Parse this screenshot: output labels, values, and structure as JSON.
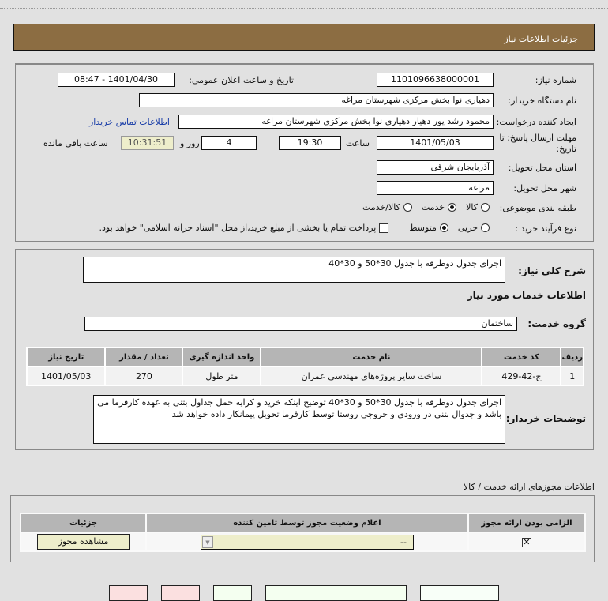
{
  "header": {
    "title": "جزئیات اطلاعات نیاز"
  },
  "info": {
    "need_number_label": "شماره نیاز:",
    "need_number": "1101096638000001",
    "announce_label": "تاریخ و ساعت اعلان عمومی:",
    "announce_value": "1401/04/30 - 08:47",
    "buyer_label": "نام دستگاه خریدار:",
    "buyer_value": "دهیاری نوا بخش مرکزی شهرستان مراغه",
    "creator_label": "ایجاد کننده درخواست:",
    "creator_value": "محمود رشد پور دهیار  دهیاری نوا بخش مرکزی شهرستان مراغه",
    "contact_link": "اطلاعات تماس خریدار",
    "deadline_label": "مهلت ارسال پاسخ: تا تاریخ:",
    "deadline_date": "1401/05/03",
    "time_label": "ساعت",
    "deadline_time": "19:30",
    "days_value": "4",
    "days_label": "روز و",
    "remaining_time": "10:31:51",
    "remaining_label": "ساعت باقی مانده",
    "province_label": "استان محل تحویل:",
    "province_value": "آذربایجان شرقی",
    "city_label": "شهر محل تحویل:",
    "city_value": "مراغه",
    "category_label": "طبقه بندی موضوعی:",
    "category_options": [
      {
        "label": "کالا",
        "selected": false
      },
      {
        "label": "خدمت",
        "selected": true
      },
      {
        "label": "کالا/خدمت",
        "selected": false
      }
    ],
    "process_label": "نوع فرآیند خرید :",
    "process_options": [
      {
        "label": "جزیی",
        "selected": false
      },
      {
        "label": "متوسط",
        "selected": true
      }
    ],
    "payment_note": "پرداخت تمام یا بخشی از مبلغ خرید،از محل \"اسناد خزانه اسلامی\" خواهد بود.",
    "payment_checked": false
  },
  "details": {
    "summary_label": "شرح کلی نیاز:",
    "summary_value": "اجرای جدول دوطرفه با جدول 30*50 و 30*40",
    "services_title": "اطلاعات خدمات مورد نیاز",
    "group_label": "گروه خدمت:",
    "group_value": "ساختمان",
    "table": {
      "headers": [
        "ردیف",
        "کد خدمت",
        "نام خدمت",
        "واحد اندازه گیری",
        "تعداد / مقدار",
        "تاریخ نیاز"
      ],
      "rows": [
        [
          "1",
          "ج-42-429",
          "ساخت سایر پروژه‌های مهندسی عمران",
          "متر طول",
          "270",
          "1401/05/03"
        ]
      ]
    },
    "buyer_notes_label": "توضیحات خریدار:",
    "buyer_notes": "اجرای جدول دوطرفه با جدول 30*50 و 30*40 توضیح اینکه خرید و کرایه حمل جداول بتنی به عهده کارفرما می باشد و جدوال بتنی در ورودی و خروجی روستا توسط کارفرما تحویل پیمانکار داده خواهد شد"
  },
  "permits": {
    "title": "اطلاعات مجوزهای ارائه خدمت / کالا",
    "headers": [
      "الزامی بودن ارائه مجوز",
      "اعلام وضعیت مجوز توسط تامین کننده",
      "جزئیات"
    ],
    "row": {
      "required": true,
      "status_value": "--",
      "details_button": "مشاهده مجوز"
    }
  },
  "colors": {
    "header": "#8c6d42",
    "highlight": "#eeeecb",
    "link": "#1a3ea8"
  }
}
